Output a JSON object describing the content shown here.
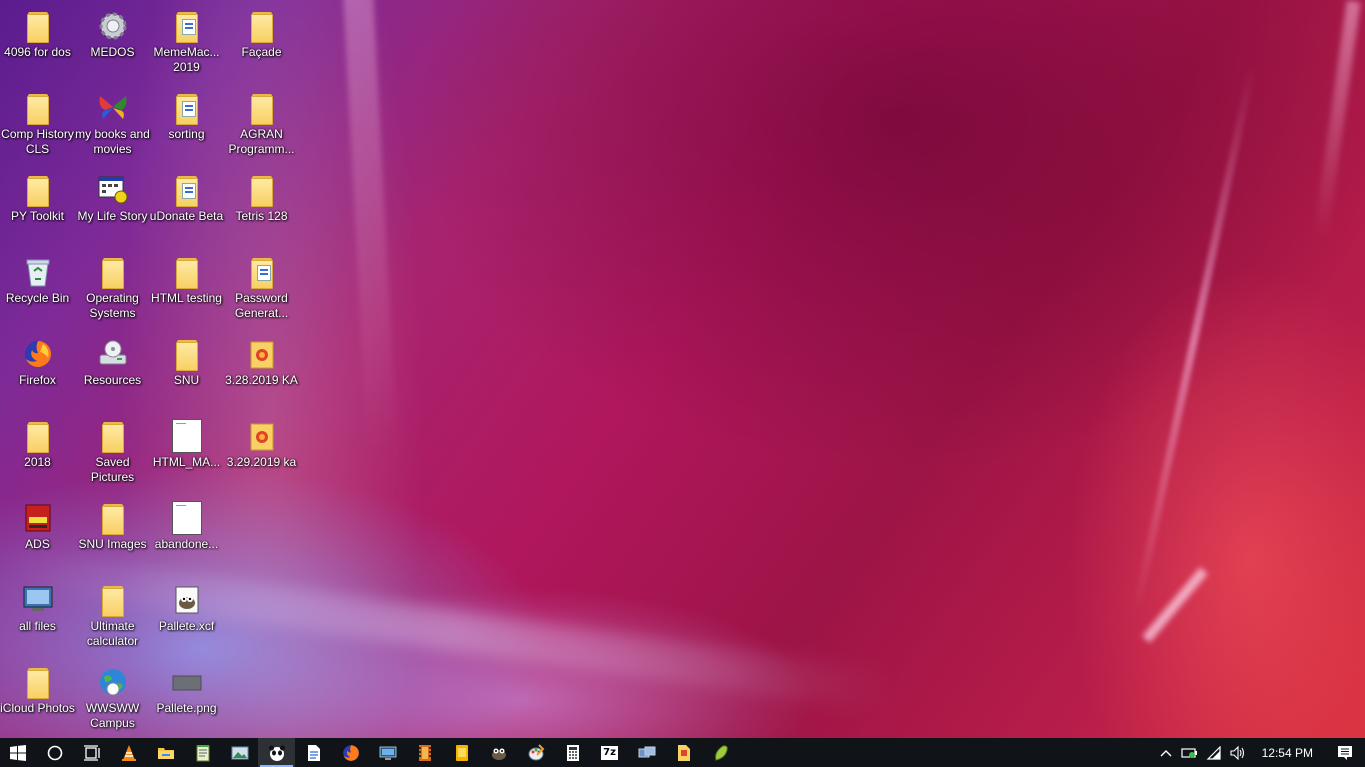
{
  "desktop": {
    "icons": [
      {
        "label": "4096 for dos",
        "icon": "folder-icon"
      },
      {
        "label": "MEDOS",
        "icon": "gear-icon"
      },
      {
        "label": "MemeMac... 2019",
        "icon": "folder-icon"
      },
      {
        "label": "Façade",
        "icon": "folder-icon"
      },
      {
        "label": "Comp History CLS",
        "icon": "folder-icon"
      },
      {
        "label": "my books and movies",
        "icon": "butterfly-icon"
      },
      {
        "label": "sorting",
        "icon": "folder-icon"
      },
      {
        "label": "AGRAN Programm...",
        "icon": "folder-icon"
      },
      {
        "label": "PY Toolkit",
        "icon": "folder-icon"
      },
      {
        "label": "My Life Story",
        "icon": "program-icon"
      },
      {
        "label": "uDonate Beta",
        "icon": "folder-icon"
      },
      {
        "label": "Tetris 128",
        "icon": "folder-icon"
      },
      {
        "label": "Recycle Bin",
        "icon": "recycle-bin-icon"
      },
      {
        "label": "Operating Systems",
        "icon": "folder-icon"
      },
      {
        "label": "HTML testing",
        "icon": "folder-icon"
      },
      {
        "label": "Password Generat...",
        "icon": "folder-icon"
      },
      {
        "label": "Firefox",
        "icon": "firefox-icon"
      },
      {
        "label": "Resources",
        "icon": "drive-icon"
      },
      {
        "label": "SNU",
        "icon": "folder-icon"
      },
      {
        "label": "3.28.2019 KA",
        "icon": "archive-folder-icon"
      },
      {
        "label": "2018",
        "icon": "folder-icon"
      },
      {
        "label": "Saved Pictures",
        "icon": "folder-icon"
      },
      {
        "label": "HTML_MA...",
        "icon": "document-icon"
      },
      {
        "label": "3.29.2019 ka",
        "icon": "archive-folder-icon"
      },
      {
        "label": "ADS",
        "icon": "app-icon"
      },
      {
        "label": "SNU Images",
        "icon": "folder-icon"
      },
      {
        "label": "abandone...",
        "icon": "document-icon"
      },
      {
        "label": "all files",
        "icon": "monitor-icon"
      },
      {
        "label": "Ultimate calculator",
        "icon": "folder-icon"
      },
      {
        "label": "Pallete.xcf",
        "icon": "gimp-icon"
      },
      {
        "label": "iCloud Photos",
        "icon": "folder-icon"
      },
      {
        "label": "WWSWW Campus",
        "icon": "globe-icon"
      },
      {
        "label": "Pallete.png",
        "icon": "image-thumbnail-icon"
      }
    ]
  },
  "taskbar": {
    "apps": [
      {
        "name": "start-button",
        "icon": "windows-logo-icon"
      },
      {
        "name": "search-button",
        "icon": "search-circle-icon"
      },
      {
        "name": "task-view-button",
        "icon": "task-view-icon"
      },
      {
        "name": "taskbar-vlc",
        "icon": "vlc-cone-icon"
      },
      {
        "name": "taskbar-file-explorer",
        "icon": "folder-icon"
      },
      {
        "name": "taskbar-notepad",
        "icon": "notepad-icon"
      },
      {
        "name": "taskbar-photos",
        "icon": "photos-icon"
      },
      {
        "name": "taskbar-panda",
        "icon": "panda-icon"
      },
      {
        "name": "taskbar-document",
        "icon": "document-icon"
      },
      {
        "name": "taskbar-firefox",
        "icon": "firefox-icon"
      },
      {
        "name": "taskbar-display",
        "icon": "display-icon"
      },
      {
        "name": "taskbar-film",
        "icon": "film-icon"
      },
      {
        "name": "taskbar-sticky",
        "icon": "sticky-note-icon"
      },
      {
        "name": "taskbar-gimp",
        "icon": "gimp-icon"
      },
      {
        "name": "taskbar-paint",
        "icon": "paint-icon"
      },
      {
        "name": "taskbar-calculator",
        "icon": "calculator-icon"
      },
      {
        "name": "taskbar-7zip",
        "icon": "seven-zip-icon"
      },
      {
        "name": "taskbar-network",
        "icon": "network-icon"
      },
      {
        "name": "taskbar-archive",
        "icon": "archive-icon"
      },
      {
        "name": "taskbar-android",
        "icon": "android-icon"
      }
    ],
    "sevenzip_label": "7z",
    "clock": "12:54 PM"
  }
}
